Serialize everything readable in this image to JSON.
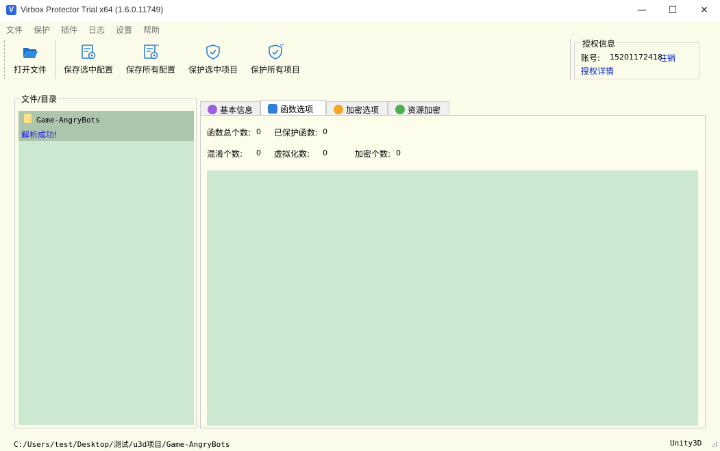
{
  "window": {
    "title": "Virbox Protector Trial x64  (1.6.0.11749)",
    "icon_letter": "V",
    "minimize": "—",
    "maximize": "☐",
    "close": "✕"
  },
  "menu": [
    "文件",
    "保护",
    "插件",
    "日志",
    "设置",
    "帮助"
  ],
  "toolbar": {
    "open_file": "打开文件",
    "save_selected_config": "保存选中配置",
    "save_all_config": "保存所有配置",
    "protect_selected": "保护选中项目",
    "protect_all": "保护所有项目"
  },
  "auth": {
    "title": "授权信息",
    "account_label": "账号:",
    "account": "15201172418",
    "logout": "注销",
    "details": "授权详情"
  },
  "files": {
    "title": "文件/目录",
    "item_name": "Game-AngryBots",
    "status": "解析成功!"
  },
  "tabs": [
    "基本信息",
    "函数选项",
    "加密选项",
    "资源加密"
  ],
  "active_tab": 1,
  "stats": {
    "total_label": "函数总个数:",
    "total": "0",
    "protected_label": "已保护函数:",
    "protected": "0",
    "obfuscate_label": "混淆个数:",
    "obfuscate": "0",
    "virtualize_label": "虚拟化数:",
    "virtualize": "0",
    "encrypt_label": "加密个数:",
    "encrypt": "0"
  },
  "status": {
    "path": "C:/Users/test/Desktop/测试/u3d项目/Game-AngryBots",
    "type": "Unity3D"
  },
  "colors": {
    "list_bg": "#cde8d1",
    "selected_bg": "#adc5ad",
    "window_bg": "#fbfbe9",
    "link": "#0a25c4",
    "status_ok": "#1a1ae6",
    "icon_blue": "#2f7fd6"
  }
}
